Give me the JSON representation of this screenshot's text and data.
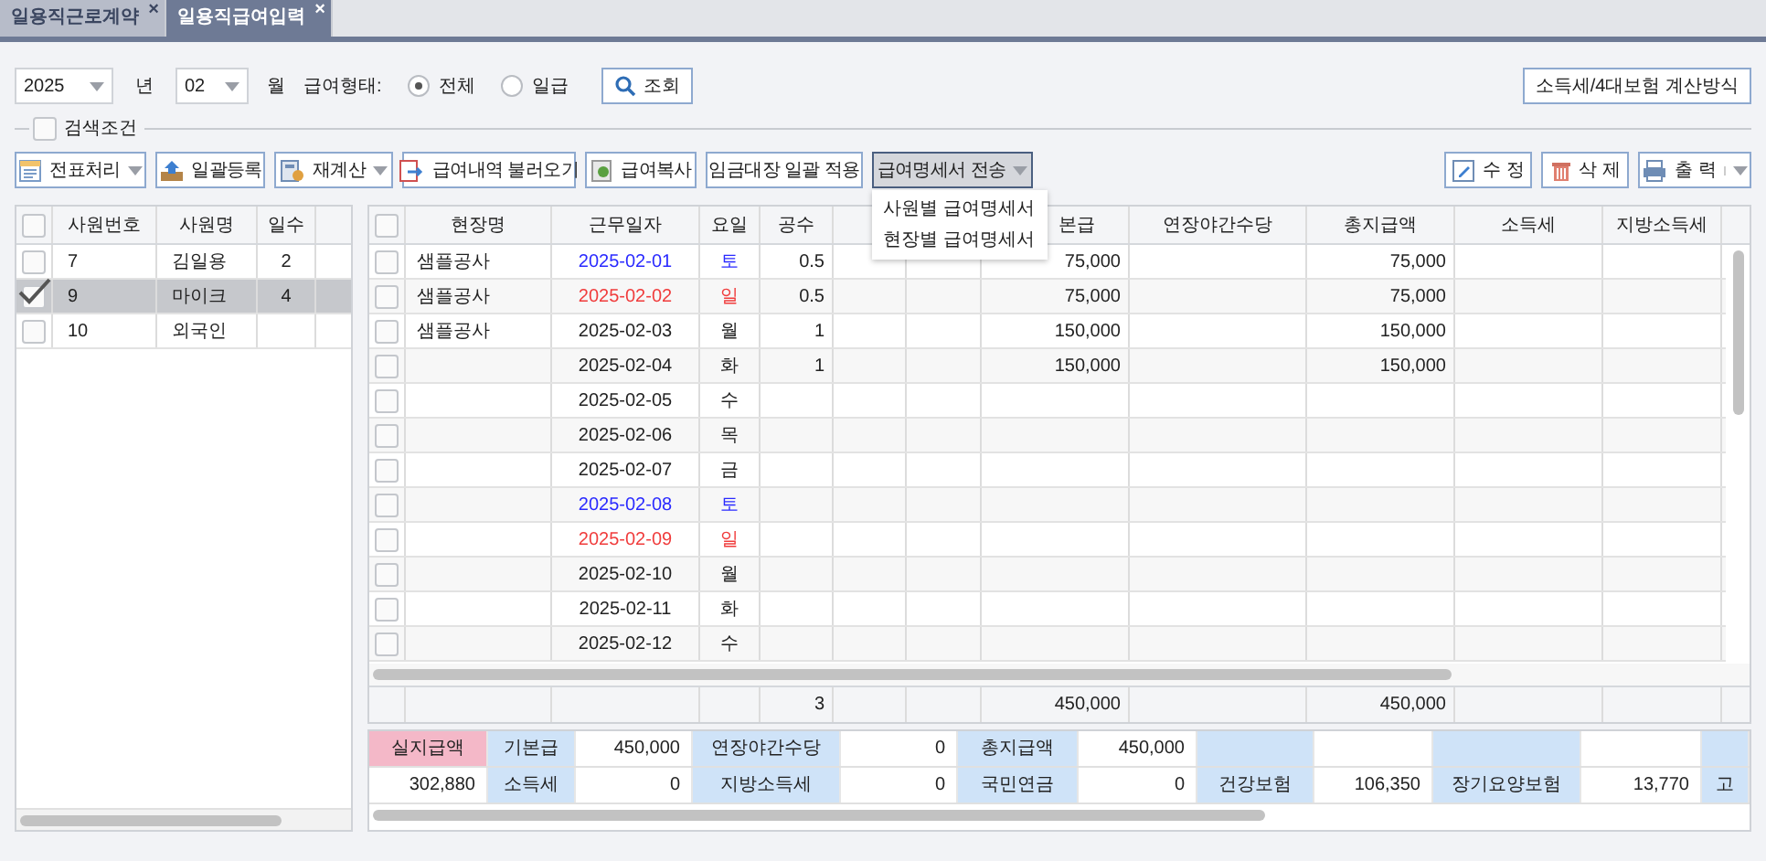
{
  "tabs": [
    {
      "label": "일용직근로계약",
      "selected": false,
      "close": "×"
    },
    {
      "label": "일용직급여입력",
      "selected": true,
      "close": "×"
    }
  ],
  "filter": {
    "year": "2025",
    "year_unit": "년",
    "month": "02",
    "month_unit": "월",
    "pay_type_label": "급여형태:",
    "pay_types": [
      {
        "label": "전체",
        "selected": true
      },
      {
        "label": "일급",
        "selected": false
      }
    ],
    "search_button": "조회",
    "calc_button": "소득세/4대보험 계산방식"
  },
  "search_conditions": {
    "label": "검색조건",
    "checked": false
  },
  "toolbar": [
    {
      "label": "전표처리",
      "dropdown": true,
      "open": false
    },
    {
      "label": "일괄등록",
      "dropdown": false,
      "open": false
    },
    {
      "label": "재계산",
      "dropdown": true,
      "open": false
    },
    {
      "label": "급여내역 불러오기",
      "dropdown": false,
      "open": false
    },
    {
      "label": "급여복사",
      "dropdown": false,
      "open": false
    },
    {
      "label": "임금대장 일괄 적용",
      "dropdown": false,
      "open": false
    },
    {
      "label": "급여명세서 전송",
      "dropdown": true,
      "open": true,
      "menu": [
        "사원별 급여명세서",
        "현장별 급여명세서"
      ]
    }
  ],
  "toolbar_right": [
    {
      "label": "수 정",
      "dropdown": false
    },
    {
      "label": "삭 제",
      "dropdown": false
    },
    {
      "label": "출 력",
      "dropdown": true
    }
  ],
  "employees": {
    "columns": [
      "사원번호",
      "사원명",
      "일수"
    ],
    "all_checked": false,
    "rows": [
      {
        "number": "7",
        "name": "김일용",
        "days": "2",
        "checked": false,
        "selected": false
      },
      {
        "number": "9",
        "name": "마이크",
        "days": "4",
        "checked": true,
        "selected": true
      },
      {
        "number": "10",
        "name": "외국인",
        "checked": false,
        "selected": false
      }
    ]
  },
  "work_table": {
    "all_checked": false,
    "columns": [
      {
        "label": "현장명"
      },
      {
        "label": "근무일자"
      },
      {
        "label": "요일"
      },
      {
        "label": "공수"
      },
      {},
      {},
      {
        "label": "본급"
      },
      {
        "label": "연장야간수당"
      },
      {
        "label": "총지급액"
      },
      {
        "label": "소득세"
      },
      {
        "label": "지방소득세"
      }
    ],
    "rows": [
      {
        "site": "샘플공사",
        "date": "2025-02-01",
        "day": "토",
        "color": "#2a2aff",
        "gongsu": "0.5",
        "basic": "75,000",
        "total": "75,000",
        "checked": false
      },
      {
        "site": "샘플공사",
        "date": "2025-02-02",
        "day": "일",
        "color": "#f03c3c",
        "gongsu": "0.5",
        "basic": "75,000",
        "total": "75,000",
        "checked": false
      },
      {
        "site": "샘플공사",
        "date": "2025-02-03",
        "day": "월",
        "color": "#222222",
        "gongsu": "1",
        "basic": "150,000",
        "total": "150,000",
        "checked": false
      },
      {
        "date": "2025-02-04",
        "day": "화",
        "color": "#222222",
        "gongsu": "1",
        "basic": "150,000",
        "total": "150,000",
        "checked": false
      },
      {
        "date": "2025-02-05",
        "day": "수",
        "color": "#222222",
        "checked": false
      },
      {
        "date": "2025-02-06",
        "day": "목",
        "color": "#222222",
        "checked": false
      },
      {
        "date": "2025-02-07",
        "day": "금",
        "color": "#222222",
        "checked": false
      },
      {
        "date": "2025-02-08",
        "day": "토",
        "color": "#2a2aff",
        "checked": false
      },
      {
        "date": "2025-02-09",
        "day": "일",
        "color": "#f03c3c",
        "checked": false
      },
      {
        "date": "2025-02-10",
        "day": "월",
        "color": "#222222",
        "checked": false
      },
      {
        "date": "2025-02-11",
        "day": "화",
        "color": "#222222",
        "checked": false
      },
      {
        "date": "2025-02-12",
        "day": "수",
        "color": "#222222",
        "checked": false
      }
    ],
    "footer": {
      "gongsu": "3",
      "basic": "450,000",
      "total": "450,000"
    }
  },
  "summary": [
    [
      {
        "kind": "net_label",
        "text": "실지급액"
      },
      {
        "kind": "label",
        "text": "기본급"
      },
      {
        "kind": "value",
        "text": "450,000"
      },
      {
        "kind": "label",
        "text": "연장야간수당"
      },
      {
        "kind": "value",
        "text": "0"
      },
      {
        "kind": "label",
        "text": "총지급액"
      },
      {
        "kind": "value",
        "text": "450,000"
      },
      {
        "kind": "label"
      },
      {
        "kind": "value"
      },
      {
        "kind": "label"
      },
      {
        "kind": "value"
      },
      {
        "kind": "label"
      }
    ],
    [
      {
        "kind": "value",
        "text": "302,880"
      },
      {
        "kind": "label",
        "text": "소득세"
      },
      {
        "kind": "value",
        "text": "0"
      },
      {
        "kind": "label",
        "text": "지방소득세"
      },
      {
        "kind": "value",
        "text": "0"
      },
      {
        "kind": "label",
        "text": "국민연금"
      },
      {
        "kind": "value",
        "text": "0"
      },
      {
        "kind": "label",
        "text": "건강보험"
      },
      {
        "kind": "value",
        "text": "106,350"
      },
      {
        "kind": "label",
        "text": "장기요양보험"
      },
      {
        "kind": "value",
        "text": "13,770"
      },
      {
        "kind": "label",
        "text": "고"
      }
    ]
  ]
}
